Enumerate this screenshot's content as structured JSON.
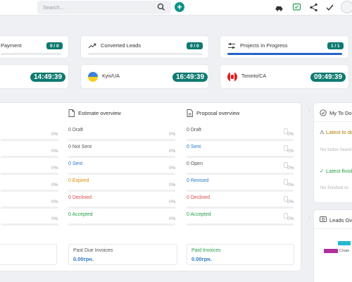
{
  "topbar": {
    "search_placeholder": "Search..."
  },
  "cards": [
    {
      "title": "Payment",
      "badge": "0 / 0"
    },
    {
      "title": "Converted Leads",
      "badge": "0 / 0"
    },
    {
      "title": "Projects In Progress",
      "badge": "1 / 1",
      "progress": 1.0
    }
  ],
  "clocks": [
    {
      "city": "",
      "time": "14:49:39"
    },
    {
      "city": "Kyiv/UA",
      "time": "16:49:39"
    },
    {
      "city": "Toronto/CA",
      "time": "09:49:39"
    }
  ],
  "invoice_col": {
    "rows": [
      {
        "label": "",
        "pct": "0%"
      },
      {
        "label": "",
        "pct": "0%"
      },
      {
        "label": "",
        "pct": "0%"
      },
      {
        "label": "",
        "pct": "0%"
      },
      {
        "label": "",
        "pct": "0%"
      },
      {
        "label": "",
        "pct": "0%"
      }
    ]
  },
  "estimate": {
    "title": "Estimate overview",
    "rows": [
      {
        "label": "0 Draft",
        "pct": "0%",
        "color": "#555555"
      },
      {
        "label": "0 Not Sent",
        "pct": "0%",
        "color": "#555555"
      },
      {
        "label": "0 Sent",
        "pct": "0%",
        "color": "#2a78c9"
      },
      {
        "label": "0 Expired",
        "pct": "0%",
        "color": "#e08a00"
      },
      {
        "label": "0 Declined",
        "pct": "0%",
        "color": "#e04848"
      },
      {
        "label": "0 Accepted",
        "pct": "0%",
        "color": "#22a04a"
      }
    ]
  },
  "proposal": {
    "title": "Proposal overview",
    "rows": [
      {
        "label": "0 Draft",
        "pct": "0%",
        "color": "#555555"
      },
      {
        "label": "0 Sent",
        "pct": "0%",
        "color": "#2a78c9"
      },
      {
        "label": "0 Open",
        "pct": "0%",
        "color": "#555555"
      },
      {
        "label": "0 Revised",
        "pct": "0%",
        "color": "#2a78c9"
      },
      {
        "label": "0 Declined",
        "pct": "0%",
        "color": "#e04848"
      },
      {
        "label": "0 Accepted",
        "pct": "0%",
        "color": "#22a04a"
      }
    ]
  },
  "invoices": [
    {
      "label": "Past Due Invoices",
      "value": "0.00грн.",
      "label_color": "#555555",
      "value_color": "#2a78c9"
    },
    {
      "label": "Paid Invoices",
      "value": "0.00грн.",
      "label_color": "#22a04a",
      "value_color": "#2a78c9"
    }
  ],
  "todo": {
    "title": "My To Do It",
    "latest_todo": "Latest to do",
    "no_todos": "No todos found",
    "latest_finished": "Latest finish",
    "no_finished": "No finished to"
  },
  "leads": {
    "title": "Leads Over",
    "legend_label": "Спам"
  },
  "colors": {
    "accent": "#0d9488",
    "badge": "#0d7a70",
    "progress": "#2563c9",
    "lead_cyan": "#22b8cf",
    "lead_magenta": "#b0309c"
  }
}
